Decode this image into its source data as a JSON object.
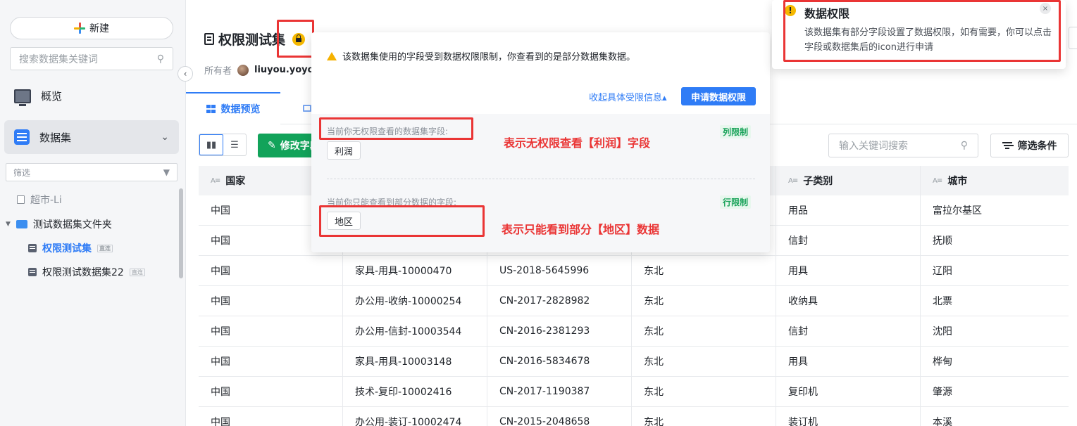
{
  "sidebar": {
    "new_label": "新建",
    "search_placeholder": "搜索数据集关键词",
    "nav_overview": "概览",
    "nav_dataset": "数据集",
    "filter_label": "筛选",
    "tree": [
      {
        "label": "超市-Li"
      },
      {
        "label": "测试数据集文件夹"
      },
      {
        "label": "权限测试集",
        "tag": "直连"
      },
      {
        "label": "权限测试数据集22",
        "tag": "直连"
      }
    ]
  },
  "header": {
    "title": "权限测试集",
    "owner_label": "所有者",
    "owner_name": "liuyou.yoyo"
  },
  "tabs": {
    "active": "数据预览"
  },
  "toolbar": {
    "modify_label": "修改字段",
    "search_placeholder": "输入关键词搜索",
    "filter_label": "筛选条件"
  },
  "table": {
    "columns": [
      "国家",
      "",
      "",
      "",
      "子类别",
      "城市"
    ],
    "rows": [
      [
        "中国",
        "",
        "",
        "",
        "用品",
        "富拉尔基区"
      ],
      [
        "中国",
        "",
        "",
        "",
        "信封",
        "抚顺"
      ],
      [
        "中国",
        "家具-用具-10000470",
        "US-2018-5645996",
        "东北",
        "用具",
        "辽阳"
      ],
      [
        "中国",
        "办公用-收纳-10000254",
        "CN-2017-2828982",
        "东北",
        "收纳具",
        "北票"
      ],
      [
        "中国",
        "办公用-信封-10003544",
        "CN-2016-2381293",
        "东北",
        "信封",
        "沈阳"
      ],
      [
        "中国",
        "家具-用具-10003148",
        "CN-2016-5834678",
        "东北",
        "用具",
        "桦甸"
      ],
      [
        "中国",
        "技术-复印-10002416",
        "CN-2017-1190387",
        "东北",
        "复印机",
        "肇源"
      ],
      [
        "中国",
        "办公用-装订-10002474",
        "CN-2015-2048658",
        "东北",
        "装订机",
        "本溪"
      ]
    ]
  },
  "popup": {
    "warning": "该数据集使用的字段受到数据权限限制，你查看到的是部分数据集数据。",
    "collapse_link": "收起具体受限信息▴",
    "apply_button": "申请数据权限",
    "col_section_label": "当前你无权限查看的数据集字段:",
    "col_field": "利润",
    "col_limit_tag": "列限制",
    "row_section_label": "当前你只能查看到部分数据的字段:",
    "row_field": "地区",
    "row_limit_tag": "行限制",
    "annotation_col": "表示无权限查看【利润】字段",
    "annotation_row": "表示只能看到部分【地区】数据"
  },
  "notification": {
    "title": "数据权限",
    "body": "该数据集有部分字段设置了数据权限，如有需要，你可以点击字段或数据集后的icon进行申请",
    "icon_glyph": "!",
    "close_glyph": "×"
  },
  "colors": {
    "accent": "#2f7cf6",
    "green": "#12a35a",
    "annotation_red": "#ea3535",
    "warning_yellow": "#f5b800"
  }
}
